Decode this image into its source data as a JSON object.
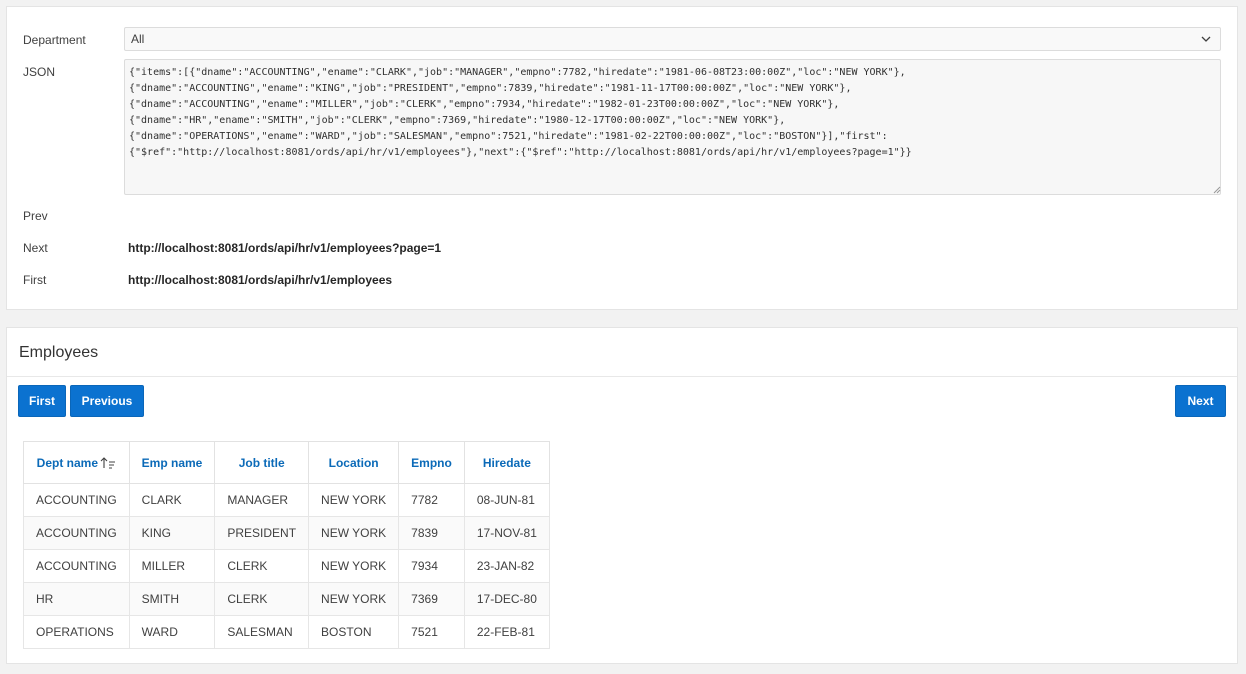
{
  "form": {
    "department_label": "Department",
    "department_value": "All",
    "json_label": "JSON",
    "json_value": "{\"items\":[{\"dname\":\"ACCOUNTING\",\"ename\":\"CLARK\",\"job\":\"MANAGER\",\"empno\":7782,\"hiredate\":\"1981-06-08T23:00:00Z\",\"loc\":\"NEW YORK\"},\n{\"dname\":\"ACCOUNTING\",\"ename\":\"KING\",\"job\":\"PRESIDENT\",\"empno\":7839,\"hiredate\":\"1981-11-17T00:00:00Z\",\"loc\":\"NEW YORK\"},\n{\"dname\":\"ACCOUNTING\",\"ename\":\"MILLER\",\"job\":\"CLERK\",\"empno\":7934,\"hiredate\":\"1982-01-23T00:00:00Z\",\"loc\":\"NEW YORK\"},\n{\"dname\":\"HR\",\"ename\":\"SMITH\",\"job\":\"CLERK\",\"empno\":7369,\"hiredate\":\"1980-12-17T00:00:00Z\",\"loc\":\"NEW YORK\"},\n{\"dname\":\"OPERATIONS\",\"ename\":\"WARD\",\"job\":\"SALESMAN\",\"empno\":7521,\"hiredate\":\"1981-02-22T00:00:00Z\",\"loc\":\"BOSTON\"}],\"first\":\n{\"$ref\":\"http://localhost:8081/ords/api/hr/v1/employees\"},\"next\":{\"$ref\":\"http://localhost:8081/ords/api/hr/v1/employees?page=1\"}}",
    "prev_label": "Prev",
    "prev_value": "",
    "next_label": "Next",
    "next_value": "http://localhost:8081/ords/api/hr/v1/employees?page=1",
    "first_label": "First",
    "first_value": "http://localhost:8081/ords/api/hr/v1/employees"
  },
  "report": {
    "title": "Employees",
    "buttons": {
      "first": "First",
      "previous": "Previous",
      "next": "Next"
    },
    "columns": [
      "Dept name",
      "Emp name",
      "Job title",
      "Location",
      "Empno",
      "Hiredate"
    ],
    "rows": [
      [
        "ACCOUNTING",
        "CLARK",
        "MANAGER",
        "NEW YORK",
        "7782",
        "08-JUN-81"
      ],
      [
        "ACCOUNTING",
        "KING",
        "PRESIDENT",
        "NEW YORK",
        "7839",
        "17-NOV-81"
      ],
      [
        "ACCOUNTING",
        "MILLER",
        "CLERK",
        "NEW YORK",
        "7934",
        "23-JAN-82"
      ],
      [
        "HR",
        "SMITH",
        "CLERK",
        "NEW YORK",
        "7369",
        "17-DEC-80"
      ],
      [
        "OPERATIONS",
        "WARD",
        "SALESMAN",
        "BOSTON",
        "7521",
        "22-FEB-81"
      ]
    ]
  },
  "icons": {
    "select": "chevron-down-icon",
    "sort": "sort-ascending-icon",
    "grip": "resize-grip-icon"
  },
  "colors": {
    "accent": "#0b72d0",
    "header_text": "#0b6ab8"
  }
}
